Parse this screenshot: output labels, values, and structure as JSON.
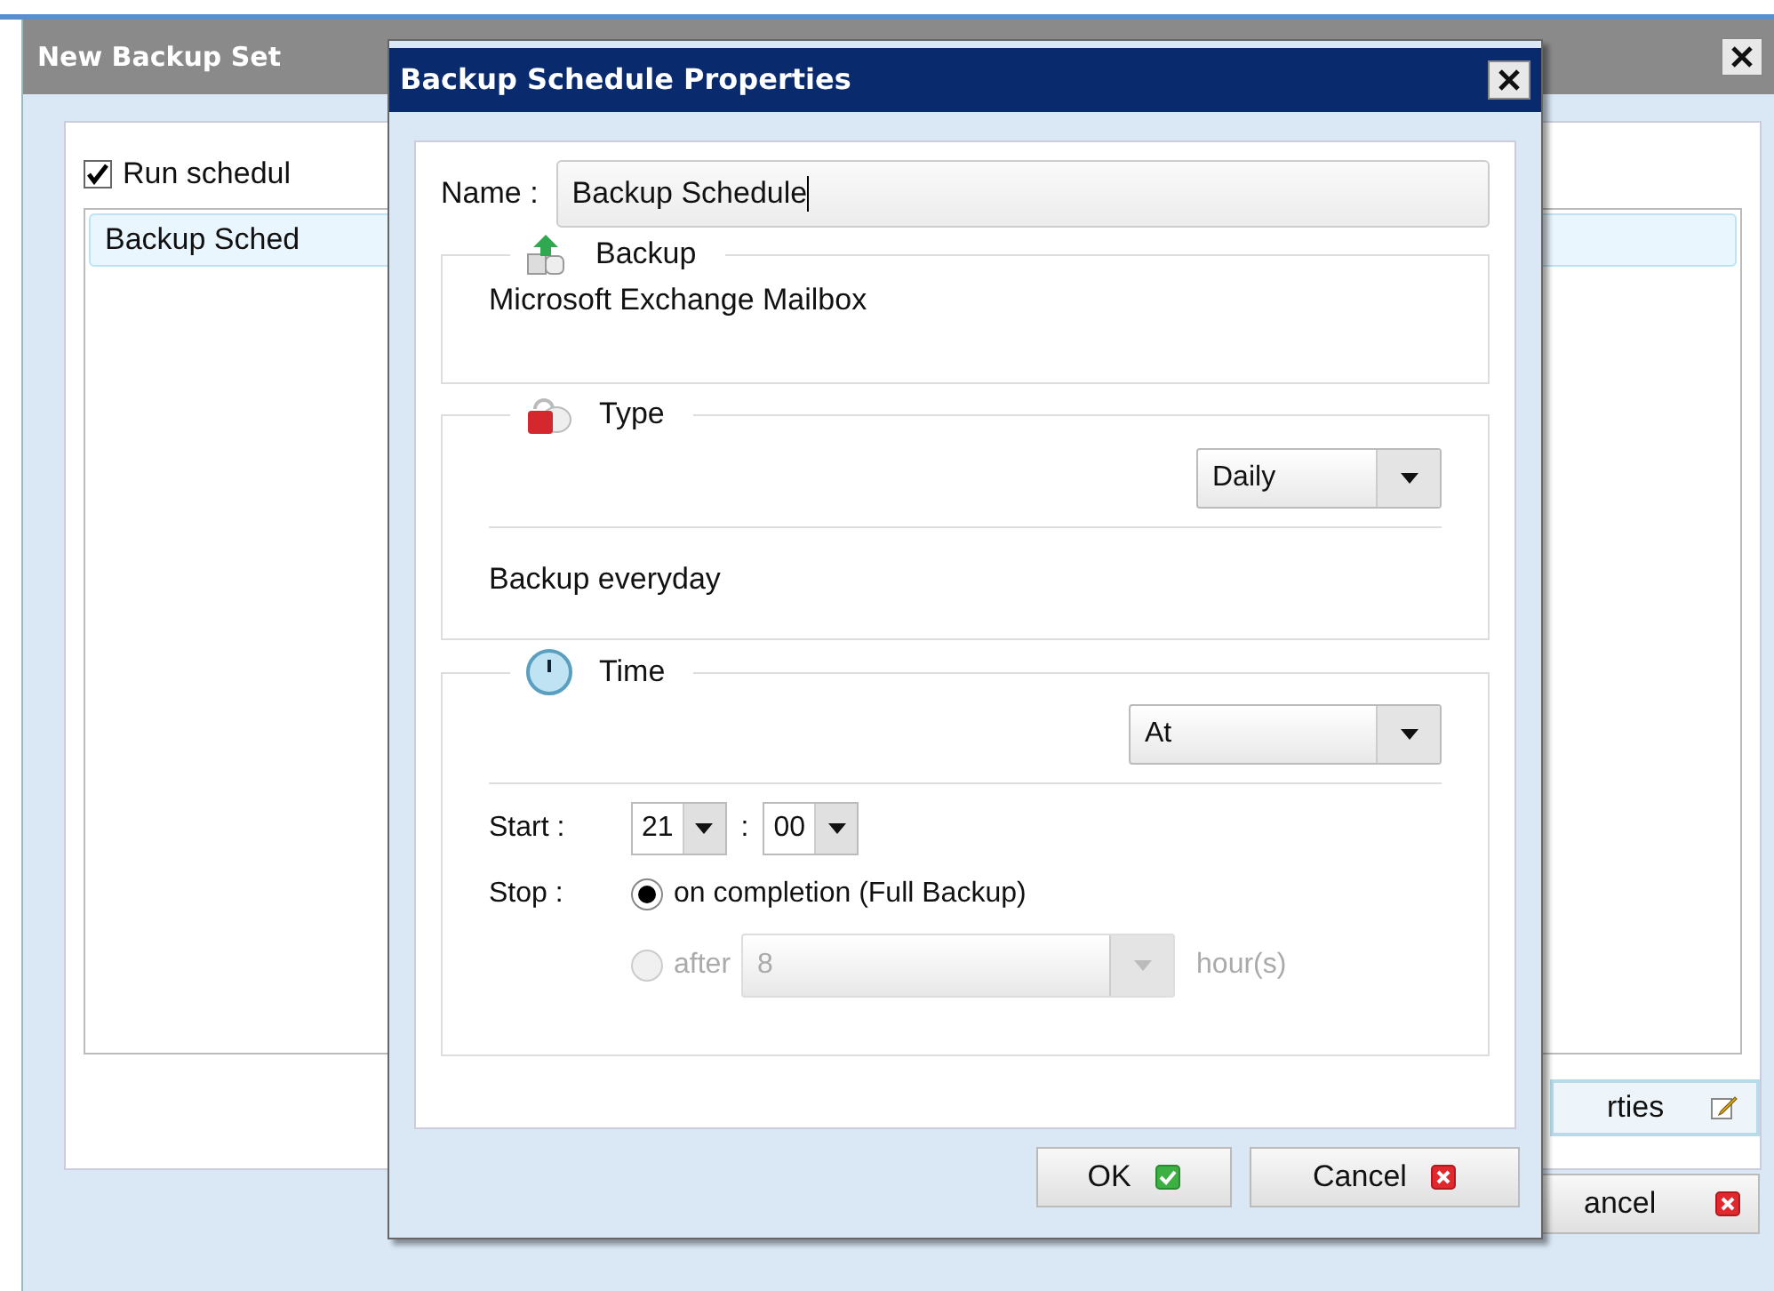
{
  "background_window": {
    "title": "New Backup Set",
    "run_scheduled": {
      "label": "Run schedul",
      "checked": true
    },
    "schedules": [
      {
        "name": "Backup Sched",
        "selected": true
      }
    ],
    "properties_button": "rties",
    "cancel_button": "ancel"
  },
  "dialog": {
    "title": "Backup Schedule Properties",
    "name_label": "Name :",
    "name_value": "Backup Schedule",
    "backup": {
      "legend": "Backup",
      "description": "Microsoft Exchange Mailbox"
    },
    "type": {
      "legend": "Type",
      "selected_option": "Daily",
      "description": "Backup everyday"
    },
    "time": {
      "legend": "Time",
      "mode": "At",
      "start_label": "Start :",
      "start_hour": "21",
      "separator": ":",
      "start_minute": "00",
      "stop_label": "Stop :",
      "stop_options": [
        {
          "label": "on completion (Full Backup)",
          "selected": true,
          "disabled": false
        },
        {
          "label": "after",
          "selected": false,
          "disabled": true
        }
      ],
      "after_hours": "8",
      "hours_unit": "hour(s)"
    },
    "buttons": [
      {
        "label": "OK",
        "kind": "ok"
      },
      {
        "label": "Cancel",
        "kind": "cancel"
      }
    ]
  }
}
